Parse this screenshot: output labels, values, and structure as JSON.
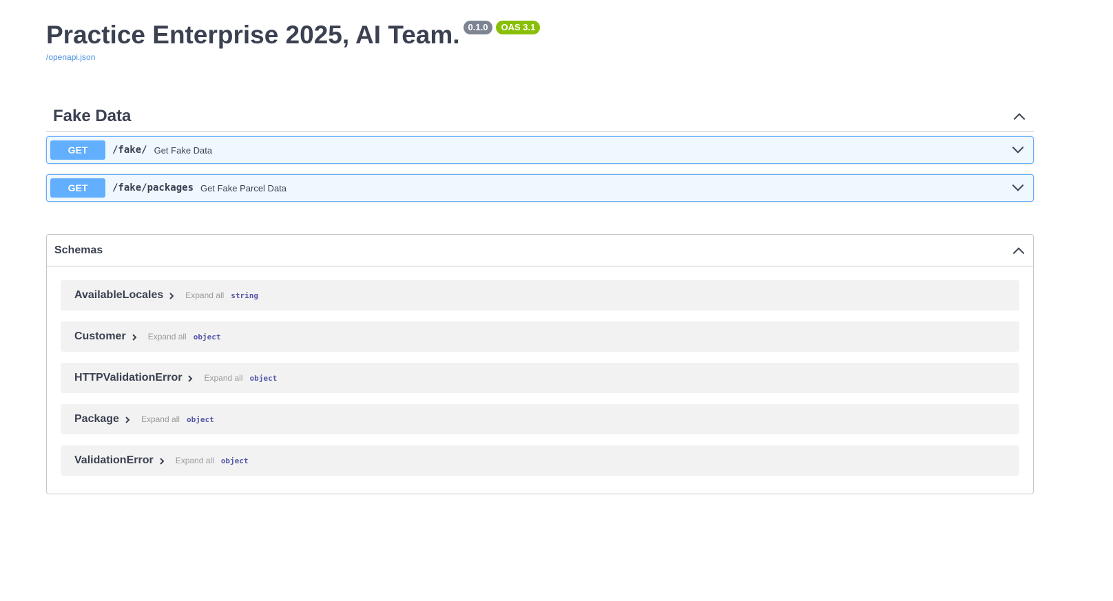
{
  "header": {
    "title": "Practice Enterprise 2025, AI Team.",
    "version_badge": "0.1.0",
    "oas_badge": "OAS 3.1",
    "spec_link": "/openapi.json"
  },
  "tag": {
    "title": "Fake Data",
    "operations": [
      {
        "method": "GET",
        "path": "/fake/",
        "summary": "Get Fake Data"
      },
      {
        "method": "GET",
        "path": "/fake/packages",
        "summary": "Get Fake Parcel Data"
      }
    ]
  },
  "schemas": {
    "title": "Schemas",
    "expand_label": "Expand all",
    "models": [
      {
        "name": "AvailableLocales",
        "type": "string"
      },
      {
        "name": "Customer",
        "type": "object"
      },
      {
        "name": "HTTPValidationError",
        "type": "object"
      },
      {
        "name": "Package",
        "type": "object"
      },
      {
        "name": "ValidationError",
        "type": "object"
      }
    ]
  },
  "colors": {
    "get": "#61affe",
    "version_badge": "#7d8492",
    "oas_badge": "#89bf04",
    "link": "#4990e2"
  }
}
